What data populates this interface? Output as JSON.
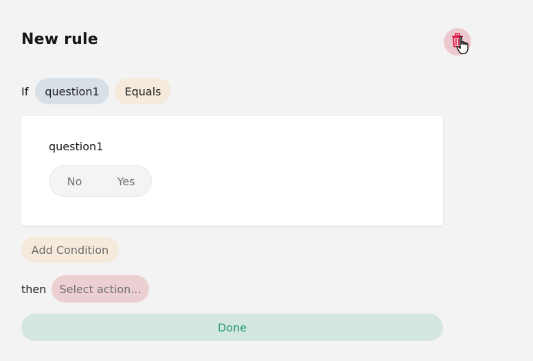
{
  "rule": {
    "title": "New rule",
    "if_label": "If",
    "condition": {
      "question": "question1",
      "operator": "Equals"
    },
    "card": {
      "question_label": "question1",
      "options": [
        "No",
        "Yes"
      ]
    },
    "add_condition_label": "Add Condition",
    "then_label": "then",
    "action_placeholder": "Select action...",
    "done_label": "Done"
  },
  "colors": {
    "delete_accent": "#e11d48",
    "done_text": "#2e9e82"
  },
  "icons": {
    "delete": "trash-icon",
    "cursor": "hand-cursor-icon"
  }
}
